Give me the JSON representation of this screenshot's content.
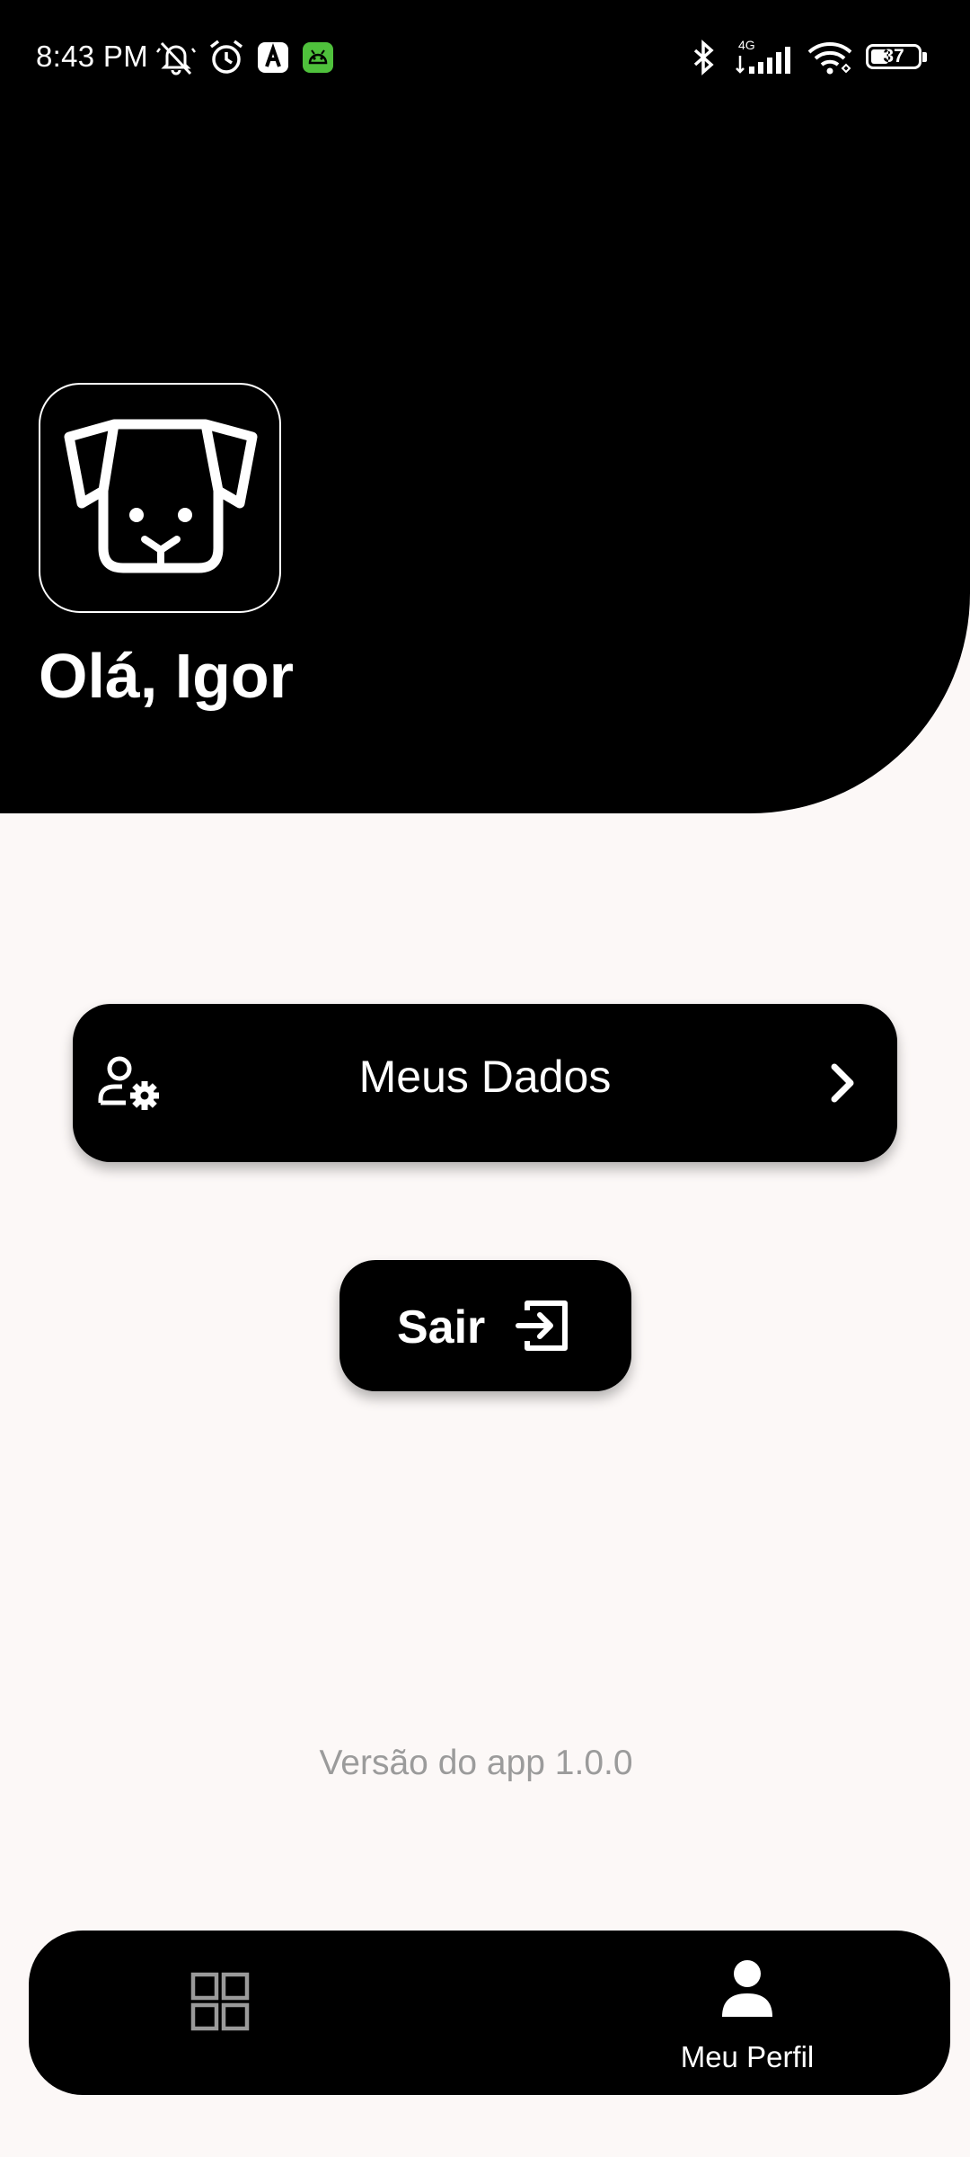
{
  "status_bar": {
    "time": "8:43 PM",
    "network": "4G",
    "battery": 37,
    "icons": [
      "muted-bell-icon",
      "alarm-icon",
      "app-notification-icon",
      "android-app-icon",
      "bluetooth-icon",
      "signal-icon",
      "wifi-icon",
      "battery-icon"
    ]
  },
  "header": {
    "greeting": "Olá, Igor",
    "avatar_icon": "dog-face-icon"
  },
  "menu": {
    "my_data_label": "Meus Dados",
    "my_data_icon": "user-settings-icon",
    "chevron_icon": "chevron-right-icon"
  },
  "logout": {
    "label": "Sair",
    "icon": "logout-icon"
  },
  "footer": {
    "version": "Versão do app 1.0.0"
  },
  "bottom_nav": {
    "items": [
      {
        "icon": "grid-icon",
        "label": "",
        "active": false
      },
      {
        "icon": "person-icon",
        "label": "Meu Perfil",
        "active": true
      }
    ]
  },
  "colors": {
    "background": "#fcf8f7",
    "primary": "#000000",
    "on_primary": "#ffffff",
    "muted_text": "#9b9b9b",
    "inactive_icon": "#9a9a9a"
  }
}
